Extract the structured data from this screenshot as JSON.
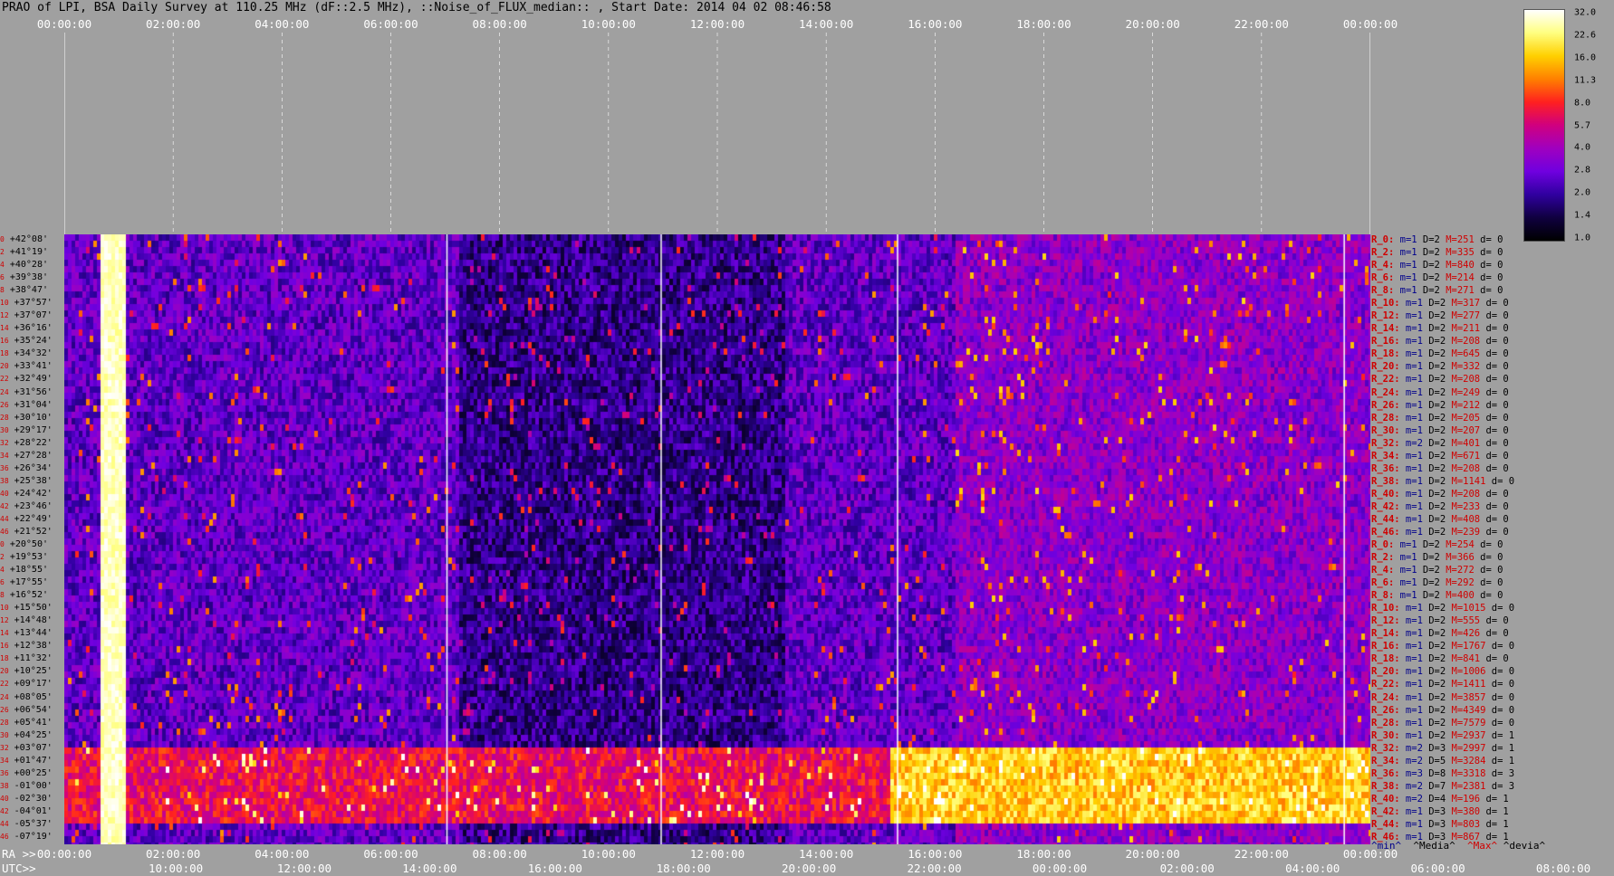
{
  "title": "PRAO of LPI, BSA Daily Survey at 110.25 MHz (dF::2.5 MHz), ::Noise_of_FLUX_median:: , Start Date: 2014 04 02 08:46:58",
  "chart_data": {
    "type": "heatmap",
    "top_axis_ticks": [
      "00:00:00",
      "02:00:00",
      "04:00:00",
      "06:00:00",
      "08:00:00",
      "10:00:00",
      "12:00:00",
      "14:00:00",
      "16:00:00",
      "18:00:00",
      "20:00:00",
      "22:00:00",
      "00:00:00"
    ],
    "ra_axis_label": "RA >>",
    "ra_axis_ticks": [
      "00:00:00",
      "02:00:00",
      "04:00:00",
      "06:00:00",
      "08:00:00",
      "10:00:00",
      "12:00:00",
      "14:00:00",
      "16:00:00",
      "18:00:00",
      "20:00:00",
      "22:00:00",
      "00:00:00"
    ],
    "utc_axis_label": "UTC>>",
    "utc_axis_ticks": [
      "10:00:00",
      "12:00:00",
      "14:00:00",
      "16:00:00",
      "18:00:00",
      "20:00:00",
      "22:00:00",
      "00:00:00",
      "02:00:00",
      "04:00:00",
      "06:00:00",
      "08:00:00"
    ],
    "colorbar_ticks": [
      "32.0",
      "22.6",
      "16.0",
      "11.3",
      "8.0",
      "5.7",
      "4.0",
      "2.8",
      "2.0",
      "1.4",
      "1.0"
    ],
    "colorbar_colors": [
      "#ffffff",
      "#ffff80",
      "#ffd000",
      "#ff8000",
      "#ff2020",
      "#d00080",
      "#a000c0",
      "#7000e0",
      "#3000a0",
      "#100040",
      "#000000"
    ],
    "rows": [
      {
        "idx": "0",
        "dec": "+42°08'",
        "r": "R_0:",
        "m": "m=1",
        "d": "D=2",
        "max": "M=251",
        "dev": "d= 0"
      },
      {
        "idx": "2",
        "dec": "+41°19'",
        "r": "R_2:",
        "m": "m=1",
        "d": "D=2",
        "max": "M=335",
        "dev": "d= 0"
      },
      {
        "idx": "4",
        "dec": "+40°28'",
        "r": "R_4:",
        "m": "m=1",
        "d": "D=2",
        "max": "M=840",
        "dev": "d= 0"
      },
      {
        "idx": "6",
        "dec": "+39°38'",
        "r": "R_6:",
        "m": "m=1",
        "d": "D=2",
        "max": "M=214",
        "dev": "d= 0"
      },
      {
        "idx": "8",
        "dec": "+38°47'",
        "r": "R_8:",
        "m": "m=1",
        "d": "D=2",
        "max": "M=271",
        "dev": "d= 0"
      },
      {
        "idx": "10",
        "dec": "+37°57'",
        "r": "R_10:",
        "m": "m=1",
        "d": "D=2",
        "max": "M=317",
        "dev": "d= 0"
      },
      {
        "idx": "12",
        "dec": "+37°07'",
        "r": "R_12:",
        "m": "m=1",
        "d": "D=2",
        "max": "M=277",
        "dev": "d= 0"
      },
      {
        "idx": "14",
        "dec": "+36°16'",
        "r": "R_14:",
        "m": "m=1",
        "d": "D=2",
        "max": "M=211",
        "dev": "d= 0"
      },
      {
        "idx": "16",
        "dec": "+35°24'",
        "r": "R_16:",
        "m": "m=1",
        "d": "D=2",
        "max": "M=208",
        "dev": "d= 0"
      },
      {
        "idx": "18",
        "dec": "+34°32'",
        "r": "R_18:",
        "m": "m=1",
        "d": "D=2",
        "max": "M=645",
        "dev": "d= 0"
      },
      {
        "idx": "20",
        "dec": "+33°41'",
        "r": "R_20:",
        "m": "m=1",
        "d": "D=2",
        "max": "M=332",
        "dev": "d= 0"
      },
      {
        "idx": "22",
        "dec": "+32°49'",
        "r": "R_22:",
        "m": "m=1",
        "d": "D=2",
        "max": "M=208",
        "dev": "d= 0"
      },
      {
        "idx": "24",
        "dec": "+31°56'",
        "r": "R_24:",
        "m": "m=1",
        "d": "D=2",
        "max": "M=249",
        "dev": "d= 0"
      },
      {
        "idx": "26",
        "dec": "+31°04'",
        "r": "R_26:",
        "m": "m=1",
        "d": "D=2",
        "max": "M=212",
        "dev": "d= 0"
      },
      {
        "idx": "28",
        "dec": "+30°10'",
        "r": "R_28:",
        "m": "m=1",
        "d": "D=2",
        "max": "M=205",
        "dev": "d= 0"
      },
      {
        "idx": "30",
        "dec": "+29°17'",
        "r": "R_30:",
        "m": "m=1",
        "d": "D=2",
        "max": "M=207",
        "dev": "d= 0"
      },
      {
        "idx": "32",
        "dec": "+28°22'",
        "r": "R_32:",
        "m": "m=2",
        "d": "D=2",
        "max": "M=401",
        "dev": "d= 0"
      },
      {
        "idx": "34",
        "dec": "+27°28'",
        "r": "R_34:",
        "m": "m=1",
        "d": "D=2",
        "max": "M=671",
        "dev": "d= 0"
      },
      {
        "idx": "36",
        "dec": "+26°34'",
        "r": "R_36:",
        "m": "m=1",
        "d": "D=2",
        "max": "M=208",
        "dev": "d= 0"
      },
      {
        "idx": "38",
        "dec": "+25°38'",
        "r": "R_38:",
        "m": "m=1",
        "d": "D=2",
        "max": "M=1141",
        "dev": "d= 0"
      },
      {
        "idx": "40",
        "dec": "+24°42'",
        "r": "R_40:",
        "m": "m=1",
        "d": "D=2",
        "max": "M=208",
        "dev": "d= 0"
      },
      {
        "idx": "42",
        "dec": "+23°46'",
        "r": "R_42:",
        "m": "m=1",
        "d": "D=2",
        "max": "M=233",
        "dev": "d= 0"
      },
      {
        "idx": "44",
        "dec": "+22°49'",
        "r": "R_44:",
        "m": "m=1",
        "d": "D=2",
        "max": "M=408",
        "dev": "d= 0"
      },
      {
        "idx": "46",
        "dec": "+21°52'",
        "r": "R_46:",
        "m": "m=1",
        "d": "D=2",
        "max": "M=239",
        "dev": "d= 0"
      },
      {
        "idx": "0",
        "dec": "+20°50'",
        "r": "R_0:",
        "m": "m=1",
        "d": "D=2",
        "max": "M=254",
        "dev": "d= 0"
      },
      {
        "idx": "2",
        "dec": "+19°53'",
        "r": "R_2:",
        "m": "m=1",
        "d": "D=2",
        "max": "M=366",
        "dev": "d= 0"
      },
      {
        "idx": "4",
        "dec": "+18°55'",
        "r": "R_4:",
        "m": "m=1",
        "d": "D=2",
        "max": "M=272",
        "dev": "d= 0"
      },
      {
        "idx": "6",
        "dec": "+17°55'",
        "r": "R_6:",
        "m": "m=1",
        "d": "D=2",
        "max": "M=292",
        "dev": "d= 0"
      },
      {
        "idx": "8",
        "dec": "+16°52'",
        "r": "R_8:",
        "m": "m=1",
        "d": "D=2",
        "max": "M=400",
        "dev": "d= 0"
      },
      {
        "idx": "10",
        "dec": "+15°50'",
        "r": "R_10:",
        "m": "m=1",
        "d": "D=2",
        "max": "M=1015",
        "dev": "d= 0"
      },
      {
        "idx": "12",
        "dec": "+14°48'",
        "r": "R_12:",
        "m": "m=1",
        "d": "D=2",
        "max": "M=555",
        "dev": "d= 0"
      },
      {
        "idx": "14",
        "dec": "+13°44'",
        "r": "R_14:",
        "m": "m=1",
        "d": "D=2",
        "max": "M=426",
        "dev": "d= 0"
      },
      {
        "idx": "16",
        "dec": "+12°38'",
        "r": "R_16:",
        "m": "m=1",
        "d": "D=2",
        "max": "M=1767",
        "dev": "d= 0"
      },
      {
        "idx": "18",
        "dec": "+11°32'",
        "r": "R_18:",
        "m": "m=1",
        "d": "D=2",
        "max": "M=841",
        "dev": "d= 0"
      },
      {
        "idx": "20",
        "dec": "+10°25'",
        "r": "R_20:",
        "m": "m=1",
        "d": "D=2",
        "max": "M=1006",
        "dev": "d= 0"
      },
      {
        "idx": "22",
        "dec": "+09°17'",
        "r": "R_22:",
        "m": "m=1",
        "d": "D=2",
        "max": "M=1411",
        "dev": "d= 0"
      },
      {
        "idx": "24",
        "dec": "+08°05'",
        "r": "R_24:",
        "m": "m=1",
        "d": "D=2",
        "max": "M=3857",
        "dev": "d= 0"
      },
      {
        "idx": "26",
        "dec": "+06°54'",
        "r": "R_26:",
        "m": "m=1",
        "d": "D=2",
        "max": "M=4349",
        "dev": "d= 0"
      },
      {
        "idx": "28",
        "dec": "+05°41'",
        "r": "R_28:",
        "m": "m=1",
        "d": "D=2",
        "max": "M=7579",
        "dev": "d= 0"
      },
      {
        "idx": "30",
        "dec": "+04°25'",
        "r": "R_30:",
        "m": "m=1",
        "d": "D=2",
        "max": "M=2937",
        "dev": "d= 1"
      },
      {
        "idx": "32",
        "dec": "+03°07'",
        "r": "R_32:",
        "m": "m=2",
        "d": "D=3",
        "max": "M=2997",
        "dev": "d= 1"
      },
      {
        "idx": "34",
        "dec": "+01°47'",
        "r": "R_34:",
        "m": "m=2",
        "d": "D=5",
        "max": "M=3284",
        "dev": "d= 1"
      },
      {
        "idx": "36",
        "dec": "+00°25'",
        "r": "R_36:",
        "m": "m=3",
        "d": "D=8",
        "max": "M=3318",
        "dev": "d= 3"
      },
      {
        "idx": "38",
        "dec": "-01°00'",
        "r": "R_38:",
        "m": "m=2",
        "d": "D=7",
        "max": "M=2381",
        "dev": "d= 3"
      },
      {
        "idx": "40",
        "dec": "-02°30'",
        "r": "R_40:",
        "m": "m=2",
        "d": "D=4",
        "max": "M=196",
        "dev": "d= 1"
      },
      {
        "idx": "42",
        "dec": "-04°01'",
        "r": "R_42:",
        "m": "m=1",
        "d": "D=3",
        "max": "M=380",
        "dev": "d= 1"
      },
      {
        "idx": "44",
        "dec": "-05°37'",
        "r": "R_44:",
        "m": "m=1",
        "d": "D=3",
        "max": "M=803",
        "dev": "d= 1"
      },
      {
        "idx": "46",
        "dec": "-07°19'",
        "r": "R_46:",
        "m": "m=1",
        "d": "D=3",
        "max": "M=867",
        "dev": "d= 1"
      }
    ],
    "legend": {
      "min": "^min^",
      "median": "^Media^",
      "max": "^Max^",
      "devia": "^devia^"
    }
  }
}
